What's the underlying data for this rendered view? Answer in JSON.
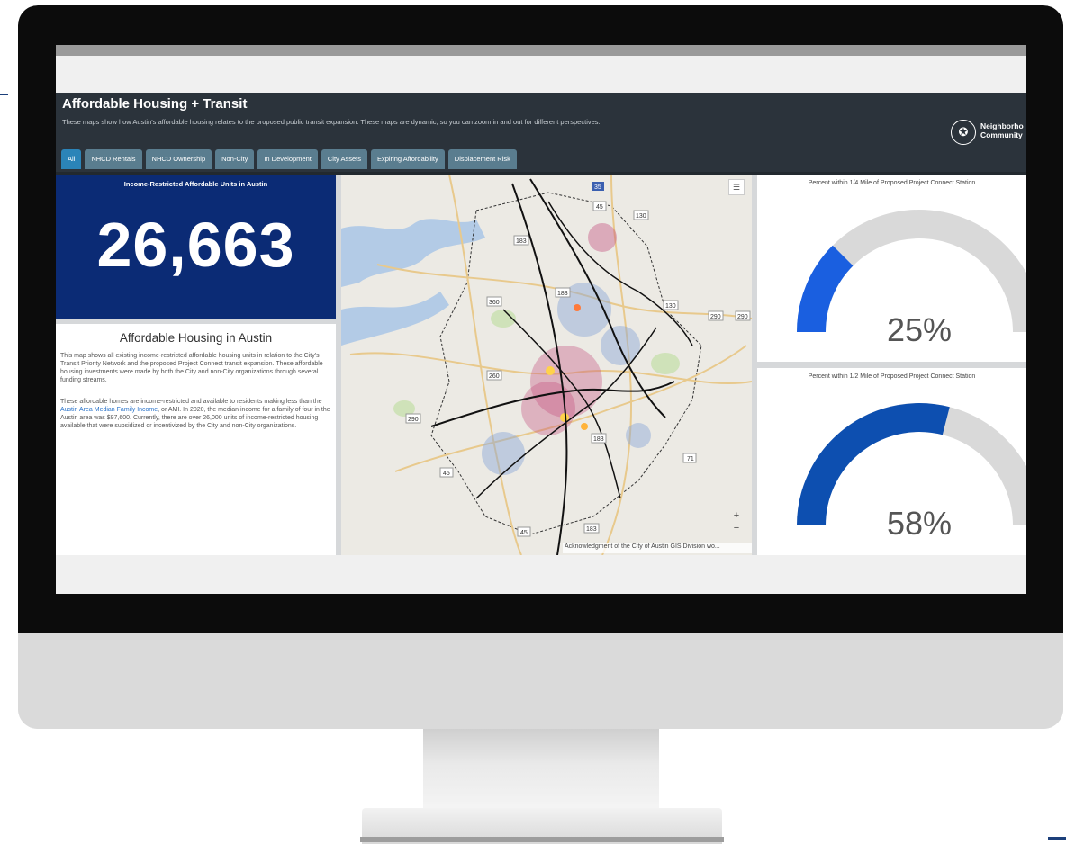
{
  "dashboard": {
    "title": "Affordable Housing + Transit",
    "subtitle": "These maps show how Austin's affordable housing relates to the proposed public transit expansion. These maps are dynamic, so you can zoom in and out for different perspectives.",
    "org_line1": "Neighborho",
    "org_line2": "Community",
    "tabs": [
      {
        "label": "All",
        "active": true
      },
      {
        "label": "NHCD Rentals"
      },
      {
        "label": "NHCD Ownership"
      },
      {
        "label": "Non-City"
      },
      {
        "label": "In Development"
      },
      {
        "label": "City Assets"
      },
      {
        "label": "Expiring Affordability"
      },
      {
        "label": "Displacement Risk"
      }
    ]
  },
  "indicator": {
    "title": "Income-Restricted Affordable Units in Austin",
    "value": "26,663"
  },
  "description": {
    "heading": "Affordable Housing in Austin",
    "p1": "This map shows all existing income-restricted affordable housing units in relation to the City's Transit Priority Network and the proposed Project Connect transit expansion. These affordable housing investments were made by both the City and non-City organizations through several funding streams.",
    "p2_before": "These affordable homes are income-restricted and available to residents making less than the ",
    "p2_link": "Austin Area Median Family Income",
    "p2_after": ", or AMI. In 2020, the median income for a family of four in the Austin area was $97,600. Currently, there are over 26,000 units of income-restricted housing available that were subsidized or incentivized by the City and non-City organizations."
  },
  "map": {
    "attribution": "Acknowledgment of the City of Austin GIS Division wo...",
    "zoom_in": "+",
    "zoom_out": "−",
    "legend_icon": "list-icon",
    "road_labels": [
      "35",
      "45",
      "130",
      "183",
      "360",
      "183",
      "130",
      "290",
      "290",
      "260",
      "290",
      "183",
      "71",
      "45",
      "183",
      "45"
    ]
  },
  "gauges": [
    {
      "title": "Percent within 1/4 Mile of Proposed Project Connect Station",
      "value": 25,
      "label": "25%",
      "color": "#1a5fe0"
    },
    {
      "title": "Percent within 1/2 Mile of Proposed Project Connect Station",
      "value": 58,
      "label": "58%",
      "color": "#0d4fb0"
    }
  ],
  "colors": {
    "header": "#2b333b",
    "tab": "#5a7d8f",
    "tab_active": "#2b84b8",
    "indicator_bg": "#0b2b75",
    "gauge_track": "#d9d9d9"
  }
}
